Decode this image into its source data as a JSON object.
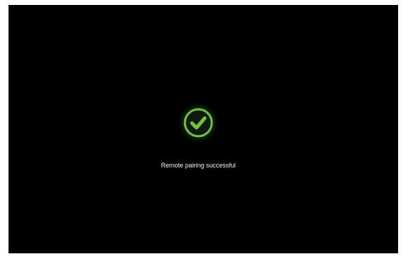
{
  "dialog": {
    "icon": "checkmark-circle-icon",
    "message": "Remote pairing successful"
  },
  "colors": {
    "screen_background": "#000000",
    "success_green": "#71c442",
    "text": "#f2f2f2",
    "frame": "#ffffff"
  }
}
